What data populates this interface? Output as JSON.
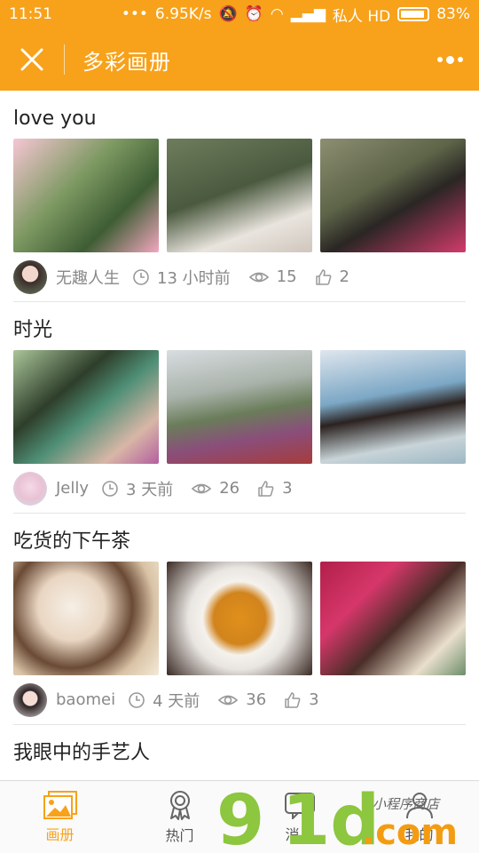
{
  "status_bar": {
    "time": "11:51",
    "network_speed": "6.95K/s",
    "carrier": "私人 HD",
    "battery": "83%"
  },
  "header": {
    "title": "多彩画册"
  },
  "albums": [
    {
      "title": "love you",
      "author": "无趣人生",
      "time_ago": "13 小时前",
      "views": "15",
      "likes": "2"
    },
    {
      "title": "时光",
      "author": "Jelly",
      "time_ago": "3 天前",
      "views": "26",
      "likes": "3"
    },
    {
      "title": "吃货的下午茶",
      "author": "baomei",
      "time_ago": "4 天前",
      "views": "36",
      "likes": "3"
    },
    {
      "title": "我眼中的手艺人"
    }
  ],
  "tabs": [
    {
      "label": "画册",
      "active": true
    },
    {
      "label": "热门"
    },
    {
      "label": "消息"
    },
    {
      "label": "我的"
    }
  ],
  "watermark": {
    "brand": "9",
    "brand2": "1d",
    "domain": ".com",
    "tag": "小程序商店"
  },
  "colors": {
    "accent": "#f7a21a",
    "watermark_green": "#8dc63f",
    "watermark_orange": "#f39c12"
  }
}
